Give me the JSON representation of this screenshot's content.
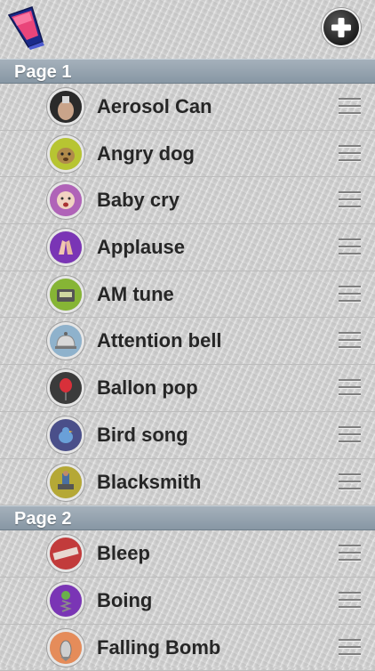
{
  "sections": [
    {
      "title": "Page 1",
      "items": [
        {
          "label": "Aerosol Can",
          "icon": "aerosol-icon",
          "color": "#2a2a2a"
        },
        {
          "label": "Angry dog",
          "icon": "dog-icon",
          "color": "#b7c532"
        },
        {
          "label": "Baby cry",
          "icon": "baby-icon",
          "color": "#b063b8"
        },
        {
          "label": "Applause",
          "icon": "hands-icon",
          "color": "#7a35b5"
        },
        {
          "label": "AM tune",
          "icon": "radio-icon",
          "color": "#86b535"
        },
        {
          "label": "Attention bell",
          "icon": "bell-icon",
          "color": "#8fb2cc"
        },
        {
          "label": "Ballon pop",
          "icon": "balloon-icon",
          "color": "#3b3b3b"
        },
        {
          "label": "Bird song",
          "icon": "bird-icon",
          "color": "#4a4f8a"
        },
        {
          "label": "Blacksmith",
          "icon": "anvil-icon",
          "color": "#b5a836"
        }
      ]
    },
    {
      "title": "Page 2",
      "items": [
        {
          "label": "Bleep",
          "icon": "censored-icon",
          "color": "#c23b3b"
        },
        {
          "label": "Boing",
          "icon": "spring-icon",
          "color": "#7a35b5"
        },
        {
          "label": "Falling Bomb",
          "icon": "bomb-icon",
          "color": "#e58c5a"
        }
      ]
    }
  ]
}
